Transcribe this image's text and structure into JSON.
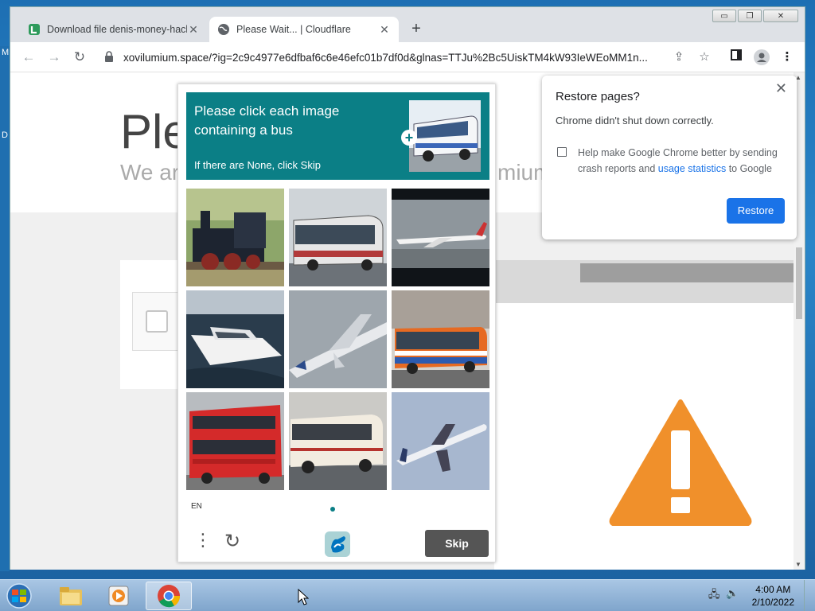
{
  "desktop": {
    "edge_letters": [
      "M",
      "D"
    ]
  },
  "window": {
    "controls": {
      "minimize": "▭",
      "restore": "❐",
      "close": "✕"
    },
    "tabs": [
      {
        "title": "Download file denis-money-hack",
        "favicon": "site-logo-icon",
        "active": false
      },
      {
        "title": "Please Wait... | Cloudflare",
        "favicon": "globe-icon",
        "active": true
      }
    ],
    "new_tab_label": "+",
    "url": "xovilumium.space/?ig=2c9c4977e6dfbaf6c6e46efc01b7df0d&glnas=TTJu%2Bc5UiskTM4kW93IeWEoMM1n...",
    "icons": [
      "back-icon",
      "forward-icon",
      "reload-icon",
      "lock-icon",
      "share-icon",
      "star-icon",
      "side-panel-icon",
      "profile-icon",
      "menu-icon"
    ]
  },
  "background_page": {
    "title": "Ple",
    "subtitle_left": "We ar",
    "subtitle_right": "mium"
  },
  "captcha": {
    "prompt": "Please click each image containing a bus",
    "hint": "If there are None, click Skip",
    "tiles": [
      "steam-locomotive",
      "bus",
      "airplane",
      "yacht",
      "airplane",
      "bus",
      "double-decker-bus",
      "bus",
      "airplane"
    ],
    "language": "EN",
    "skip_label": "Skip"
  },
  "restore_dialog": {
    "title": "Restore pages?",
    "message": "Chrome didn't shut down correctly.",
    "checkbox_text_1": "Help make Google Chrome better by sending crash reports and ",
    "checkbox_link": "usage statistics",
    "checkbox_text_2": " to Google",
    "checked": false,
    "button_label": "Restore",
    "close_label": "✕"
  },
  "taskbar": {
    "apps": [
      "file-explorer-icon",
      "media-player-icon",
      "chrome-icon"
    ],
    "time": "4:00 AM",
    "date": "2/10/2022"
  },
  "colors": {
    "captcha_header": "#0b7f86",
    "restore_button": "#1a73e8",
    "warning": "#f0902b"
  }
}
